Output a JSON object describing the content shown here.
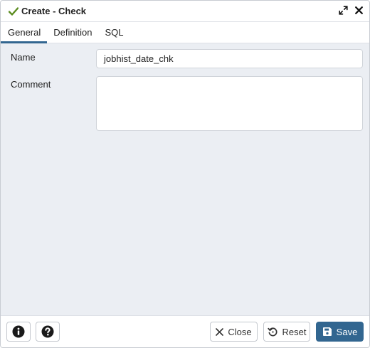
{
  "dialog": {
    "title": "Create - Check",
    "icons": {
      "title": "check-icon",
      "expand": "expand-icon",
      "close": "close-icon"
    }
  },
  "tabs": [
    {
      "label": "General",
      "active": true
    },
    {
      "label": "Definition",
      "active": false
    },
    {
      "label": "SQL",
      "active": false
    }
  ],
  "form": {
    "name_label": "Name",
    "name_value": "jobhist_date_chk",
    "comment_label": "Comment",
    "comment_value": ""
  },
  "footer": {
    "info_icon": "info-icon",
    "help_icon": "help-icon",
    "close_label": "Close",
    "reset_label": "Reset",
    "save_label": "Save"
  },
  "colors": {
    "accent": "#326690",
    "check": "#5b8c1f",
    "background": "#ebeef3"
  }
}
